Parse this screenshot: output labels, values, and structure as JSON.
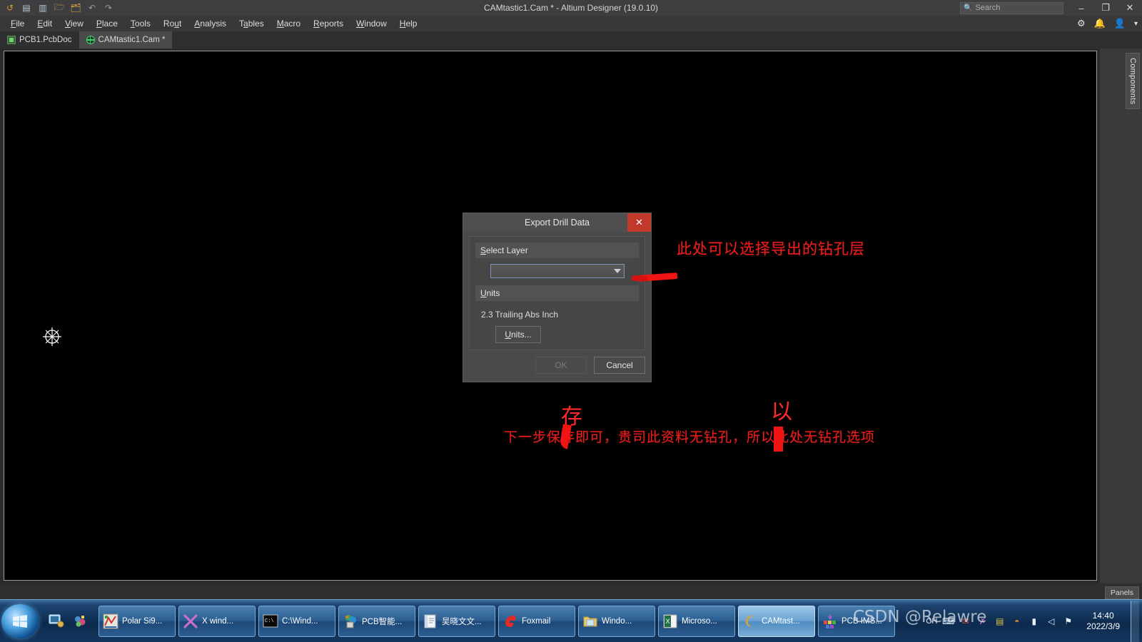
{
  "window": {
    "title": "CAMtastic1.Cam * - Altium Designer (19.0.10)",
    "minimize_label": "–",
    "restore_label": "❐",
    "close_label": "✕"
  },
  "search": {
    "placeholder": "Search",
    "value": "",
    "icon": "search-icon"
  },
  "quick_toolbar": [
    {
      "name": "altium-logo-icon",
      "glyph": "↺"
    },
    {
      "name": "save-icon",
      "glyph": "▤"
    },
    {
      "name": "save-as-icon",
      "glyph": "▥"
    },
    {
      "name": "open-file-icon",
      "glyph": "🗁"
    },
    {
      "name": "open-project-icon",
      "glyph": "🗂"
    },
    {
      "name": "undo-icon",
      "glyph": "↶"
    },
    {
      "name": "redo-icon",
      "glyph": "↷"
    }
  ],
  "menubar": {
    "items": [
      {
        "pre": "",
        "key": "F",
        "post": "ile"
      },
      {
        "pre": "",
        "key": "E",
        "post": "dit"
      },
      {
        "pre": "",
        "key": "V",
        "post": "iew"
      },
      {
        "pre": "",
        "key": "P",
        "post": "lace"
      },
      {
        "pre": "",
        "key": "T",
        "post": "ools"
      },
      {
        "pre": "Ro",
        "key": "u",
        "post": "t"
      },
      {
        "pre": "",
        "key": "A",
        "post": "nalysis"
      },
      {
        "pre": "T",
        "key": "a",
        "post": "bles"
      },
      {
        "pre": "",
        "key": "M",
        "post": "acro"
      },
      {
        "pre": "",
        "key": "R",
        "post": "eports"
      },
      {
        "pre": "",
        "key": "W",
        "post": "indow"
      },
      {
        "pre": "",
        "key": "H",
        "post": "elp"
      }
    ],
    "right_icons": [
      {
        "name": "settings-gear-icon",
        "glyph": "⚙"
      },
      {
        "name": "notifications-bell-icon",
        "glyph": "🔔"
      },
      {
        "name": "account-icon",
        "glyph": "👤"
      },
      {
        "name": "chevron-down-icon",
        "glyph": "▾"
      }
    ]
  },
  "doc_tabs": [
    {
      "label": "PCB1.PcbDoc",
      "icon": "pcb-doc-icon",
      "active": false
    },
    {
      "label": "CAMtastic1.Cam *",
      "icon": "cam-doc-icon",
      "active": true
    }
  ],
  "right_rail": {
    "components_tab": "Components"
  },
  "status_bar": {
    "panels_button": "Panels"
  },
  "canvas": {
    "cursor": "crosshair-circle-cursor"
  },
  "dialog": {
    "title": "Export Drill Data",
    "close_label": "✕",
    "select_layer": {
      "group_key": "S",
      "group_rest": "elect Layer",
      "value": "",
      "placeholder": "",
      "dropdown_icon": "chevron-down-icon"
    },
    "units": {
      "group_key": "U",
      "group_rest": "nits",
      "value": "2.3 Trailing Abs Inch",
      "button_key": "U",
      "button_rest": "nits..."
    },
    "buttons": {
      "ok": "OK",
      "ok_disabled": true,
      "cancel": "Cancel"
    }
  },
  "annotations": {
    "top": "此处可以选择导出的钻孔层",
    "bottom": "下一步保存即可，贵司此资料无钻孔，所以此处无钻孔选项",
    "ime_char_1": "存",
    "ime_char_2": "以",
    "color": "#e81d1d"
  },
  "taskbar": {
    "start_label": "Start",
    "quick_launch": [
      {
        "name": "show-desktop-icon",
        "glyph": "🖥"
      },
      {
        "name": "media-icon",
        "glyph": "🎨"
      }
    ],
    "buttons": [
      {
        "label": "Polar Si9...",
        "icon": "polar-si9000-icon",
        "active": false
      },
      {
        "label": "X wind...",
        "icon": "xwindow-icon",
        "active": false
      },
      {
        "label": "C:\\Wind...",
        "icon": "command-prompt-icon",
        "active": false
      },
      {
        "label": "PCB智能...",
        "icon": "pcb-tool-icon",
        "active": false
      },
      {
        "label": "吴晓文文...",
        "icon": "notepad-icon",
        "active": false
      },
      {
        "label": "Foxmail",
        "icon": "foxmail-icon",
        "active": false
      },
      {
        "label": "Windo...",
        "icon": "explorer-icon",
        "active": false
      },
      {
        "label": "Microso...",
        "icon": "excel-icon",
        "active": false
      },
      {
        "label": "CAMtast...",
        "icon": "altium-icon",
        "active": true
      },
      {
        "label": "PCB IMS...",
        "icon": "pcb-ims-icon",
        "active": false
      }
    ],
    "tray": {
      "ime_lang": "CH",
      "icons": [
        {
          "name": "ime-keyboard-icon",
          "glyph": "⌨"
        },
        {
          "name": "foxmail-tray-icon",
          "glyph": "✉"
        },
        {
          "name": "xwindow-tray-icon",
          "glyph": "✗"
        },
        {
          "name": "window-tray-icon",
          "glyph": "▤"
        },
        {
          "name": "antivirus-tray-icon",
          "glyph": "◓"
        },
        {
          "name": "network-tray-icon",
          "glyph": "▮"
        },
        {
          "name": "volume-tray-icon",
          "glyph": "◁"
        },
        {
          "name": "action-center-tray-icon",
          "glyph": "⚑"
        }
      ],
      "time": "14:40",
      "date": "2022/3/9"
    }
  },
  "watermark": {
    "text": "CSDN @Relawre"
  }
}
